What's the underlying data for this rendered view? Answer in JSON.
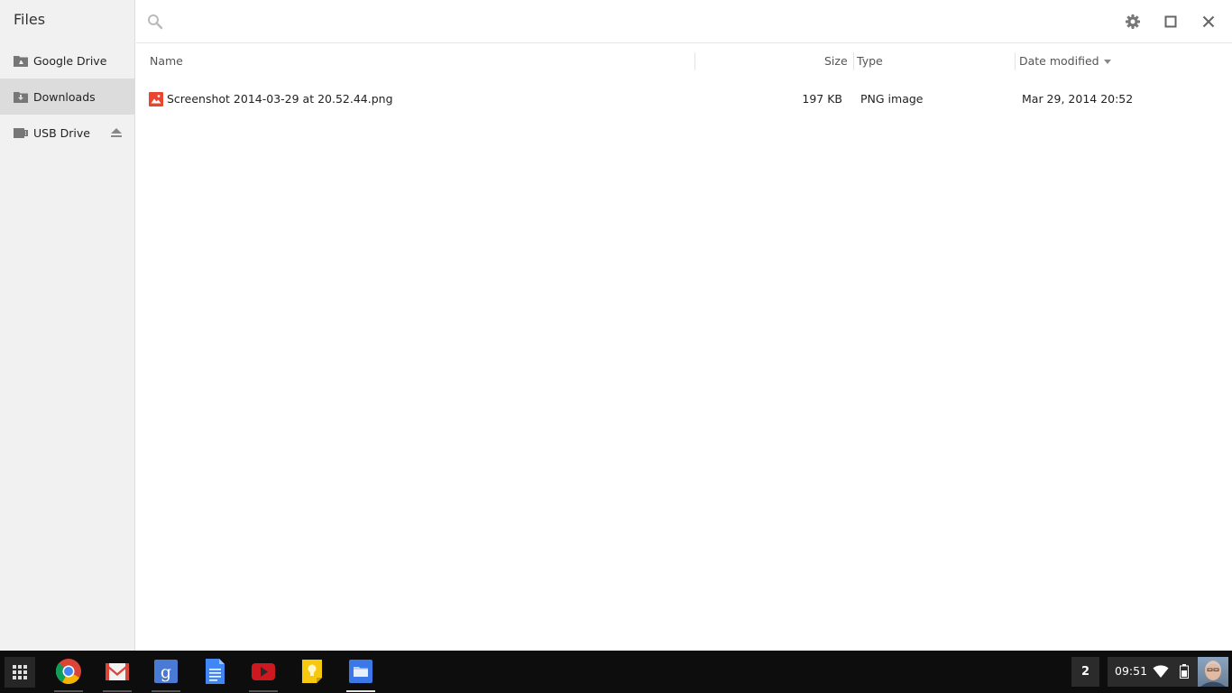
{
  "sidebar": {
    "title": "Files",
    "items": [
      {
        "label": "Google Drive",
        "icon": "google-drive-folder-icon"
      },
      {
        "label": "Downloads",
        "icon": "downloads-folder-icon",
        "active": true
      },
      {
        "label": "USB Drive",
        "icon": "usb-drive-icon",
        "ejectable": true
      }
    ]
  },
  "toolbar": {
    "search_placeholder": "",
    "icons": [
      "search-icon",
      "gear-icon",
      "maximize-icon",
      "close-icon"
    ]
  },
  "columns": {
    "name": "Name",
    "size": "Size",
    "type": "Type",
    "date": "Date modified"
  },
  "files": [
    {
      "name": "Screenshot 2014-03-29 at 20.52.44.png",
      "size": "197 KB",
      "type": "PNG image",
      "date": "Mar 29, 2014 20:52",
      "icon": "image-file-icon"
    }
  ],
  "shelf": {
    "apps": [
      "chrome",
      "gmail",
      "google-search",
      "docs",
      "youtube",
      "keep",
      "files"
    ],
    "notification_count": "2",
    "clock": "09:51",
    "colors": {
      "background": "#0d0d0d",
      "tray": "#2b2b2b"
    }
  },
  "colors": {
    "sidebar_bg": "#f1f1f1",
    "active_item": "#dcdcdc",
    "image_icon_red": "#e8462f"
  }
}
